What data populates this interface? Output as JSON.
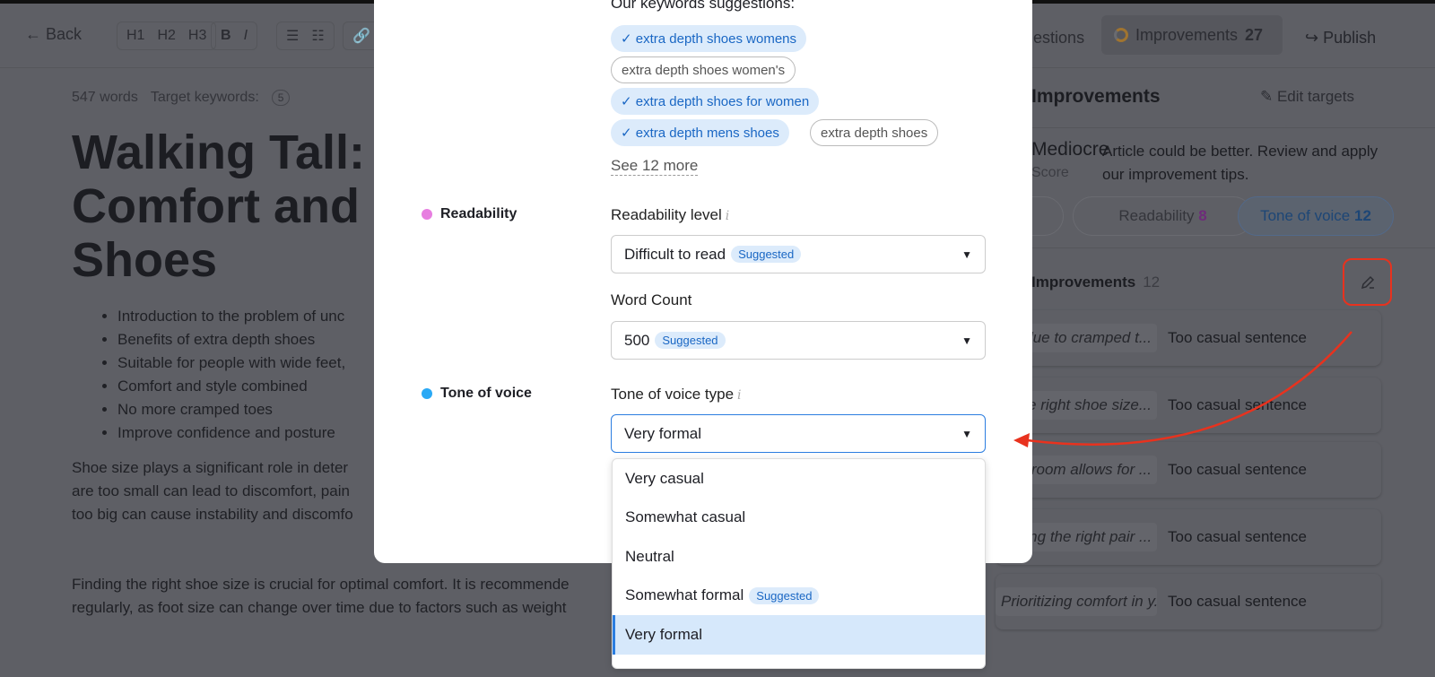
{
  "toolbar": {
    "back": "Back",
    "headings": [
      "H1",
      "H2",
      "H3"
    ],
    "format": [
      "B",
      "I"
    ],
    "suggestions_tab": "Suggestions",
    "improvements_label": "Improvements",
    "improvements_count": "27",
    "publish": "Publish"
  },
  "editor": {
    "word_count": "547 words",
    "target_keywords_label": "Target keywords:",
    "target_keywords_count": "5",
    "title_lines": [
      "Walking Tall: I",
      "Comfort and S",
      "Shoes"
    ],
    "bullets": [
      "Introduction to the problem of unc",
      "Benefits of extra depth shoes",
      "Suitable for people with wide feet,",
      "Comfort and style combined",
      "No more cramped toes",
      "Improve confidence and posture"
    ],
    "para1": [
      "Shoe size plays a significant role in deter",
      "are too small can lead to discomfort, pain",
      "too big can cause instability and discomfo"
    ],
    "para2": [
      "Finding the right shoe size is crucial for optimal comfort. It is recommende",
      "regularly, as foot size can change over time due to factors such as weight"
    ]
  },
  "panel": {
    "heading": "Improvements",
    "edit_targets": "Edit targets",
    "score": "Mediocre",
    "score_sub": "Score",
    "score_desc": "Article could be better. Review and apply our improvement tips.",
    "pills": [
      {
        "label": "Readability",
        "count": "8",
        "count_color": "#a43ab8"
      },
      {
        "label": "Tone of voice",
        "count": "12"
      }
    ],
    "list_title": "Improvements",
    "list_count": "12",
    "items": [
      {
        "snippet": "due to cramped t...",
        "reason": "Too casual sentence"
      },
      {
        "snippet": "the right shoe size...",
        "reason": "Too casual sentence"
      },
      {
        "snippet": "room allows for ...",
        "reason": "Too casual sentence"
      },
      {
        "snippet": "finding the right pair ...",
        "reason": "Too casual sentence"
      },
      {
        "snippet": "Prioritizing comfort in y...",
        "reason": "Too casual sentence"
      }
    ]
  },
  "modal": {
    "keywords_heading": "Our keywords suggestions:",
    "keywords": [
      {
        "text": "extra depth shoes womens",
        "selected": true
      },
      {
        "text": "extra depth shoes women's",
        "selected": false
      },
      {
        "text": "extra depth shoes for women",
        "selected": true
      },
      {
        "text": "extra depth mens shoes",
        "selected": true
      },
      {
        "text": "extra depth shoes",
        "selected": false
      }
    ],
    "see_more": "See 12 more",
    "readability": {
      "section": "Readability",
      "color": "#e77ee0",
      "level_label": "Readability level",
      "level_value": "Difficult to read",
      "level_badge": "Suggested",
      "wc_label": "Word Count",
      "wc_value": "500",
      "wc_badge": "Suggested"
    },
    "tone": {
      "section": "Tone of voice",
      "color": "#2aa9f5",
      "type_label": "Tone of voice type",
      "value": "Very formal",
      "options": [
        {
          "label": "Very casual"
        },
        {
          "label": "Somewhat casual"
        },
        {
          "label": "Neutral"
        },
        {
          "label": "Somewhat formal",
          "badge": "Suggested"
        },
        {
          "label": "Very formal",
          "selected": true
        }
      ]
    }
  },
  "annotation": {
    "color": "#e8321e"
  }
}
